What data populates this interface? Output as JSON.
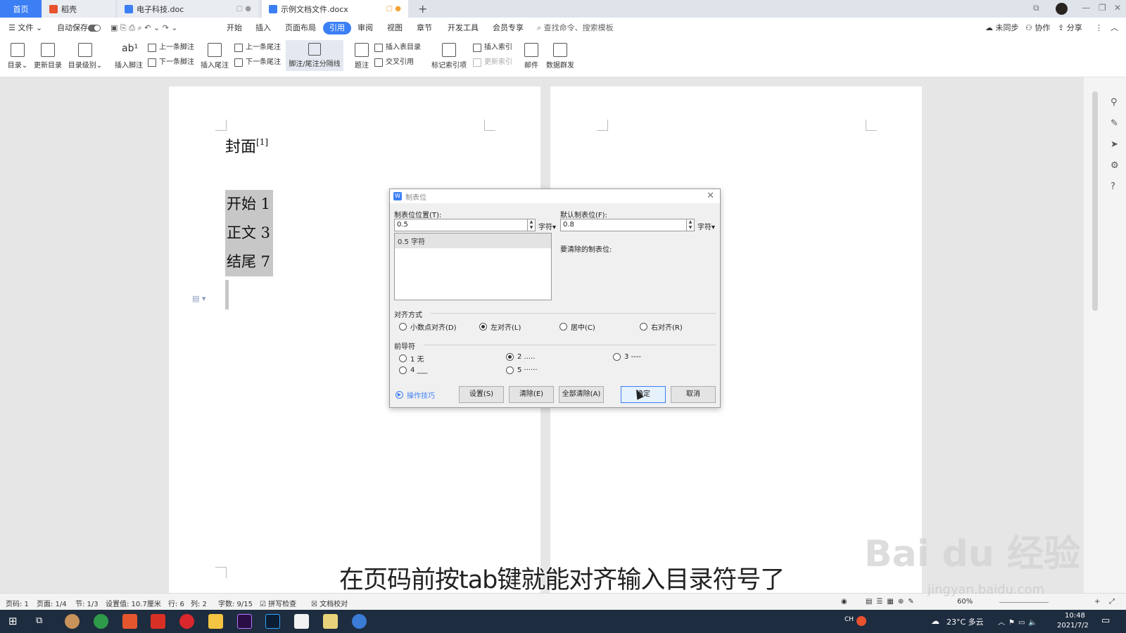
{
  "tabs": [
    {
      "label": "首页"
    },
    {
      "label": "稻壳"
    },
    {
      "label": "电子科技.doc"
    },
    {
      "label": "示例文档文件.docx"
    }
  ],
  "menu": {
    "file": "文件",
    "autosave": "自动保存",
    "items": [
      "开始",
      "插入",
      "页面布局",
      "引用",
      "审阅",
      "视图",
      "章节",
      "开发工具",
      "会员专享"
    ],
    "active": "引用",
    "search": "查找命令、搜索模板",
    "right": [
      "未同步",
      "协作",
      "分享"
    ]
  },
  "ribbon": {
    "toc": "目录",
    "update_toc": "更新目录",
    "toc_level": "目录级别",
    "insert_footnote": "插入脚注",
    "prev_footnote": "上一条脚注",
    "next_footnote": "下一条脚注",
    "insert_endnote": "插入尾注",
    "prev_endnote": "上一条尾注",
    "next_endnote": "下一条尾注",
    "separator": "脚注/尾注分隔线",
    "caption": "题注",
    "insert_table_toc": "插入表目录",
    "cross_ref": "交叉引用",
    "mark_index": "标记索引项",
    "insert_index": "插入索引",
    "update_index": "更新索引",
    "mail": "邮件",
    "data_send": "数据群发"
  },
  "document": {
    "title": "封面",
    "title_sup": "[1]",
    "toc_lines": [
      "开始 1",
      "正文 3",
      "结尾 7"
    ]
  },
  "dialog": {
    "title": "制表位",
    "tab_pos_label": "制表位位置(T):",
    "tab_pos_value": "0.5",
    "unit": "字符",
    "default_label": "默认制表位(F):",
    "default_value": "0.8",
    "list_items": [
      "0.5 字符"
    ],
    "to_clear_label": "要清除的制表位:",
    "align_label": "对齐方式",
    "align_options": [
      "小数点对齐(D)",
      "左对齐(L)",
      "居中(C)",
      "右对齐(R)"
    ],
    "align_selected": 1,
    "leader_label": "前导符",
    "leader_options": [
      "1 无",
      "2 .....",
      "3 ----",
      "4 ___",
      "5 ······"
    ],
    "leader_selected": 1,
    "tips": "操作技巧",
    "btn_set": "设置(S)",
    "btn_clear": "清除(E)",
    "btn_clear_all": "全部清除(A)",
    "btn_ok": "确定",
    "btn_cancel": "取消"
  },
  "status": {
    "page_num": "页码: 1",
    "pages": "页面: 1/4",
    "section": "节: 1/3",
    "setting": "设置值: 10.7厘米",
    "row": "行: 6",
    "col": "列: 2",
    "words": "字数: 9/15",
    "spell": "拼写检查",
    "proof": "文档校对",
    "zoom": "60%"
  },
  "taskbar": {
    "weather": "23°C 多云",
    "time": "10:48",
    "date": "2021/7/2",
    "ime": "CH"
  },
  "overlay": {
    "subtitle": "在页码前按tab键就能对齐输入目录符号了",
    "watermark": "Bai du 经验",
    "watermark_url": "jingyan.baidu.com"
  }
}
